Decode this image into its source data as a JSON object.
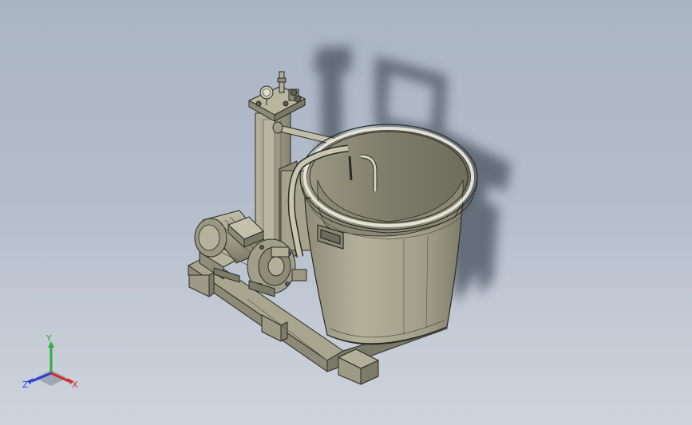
{
  "viewport": {
    "background_top": "#aab5c4",
    "background_bottom": "#cfd4dc"
  },
  "triad": {
    "x_label": "X",
    "y_label": "Y",
    "z_label": "Z",
    "x_color": "#d42a2a",
    "y_color": "#2fae3a",
    "z_color": "#2a3fd4"
  },
  "model": {
    "body_color": "#a3a08a",
    "edge_color": "#2b2b26",
    "shadow_color": "#56606c"
  }
}
